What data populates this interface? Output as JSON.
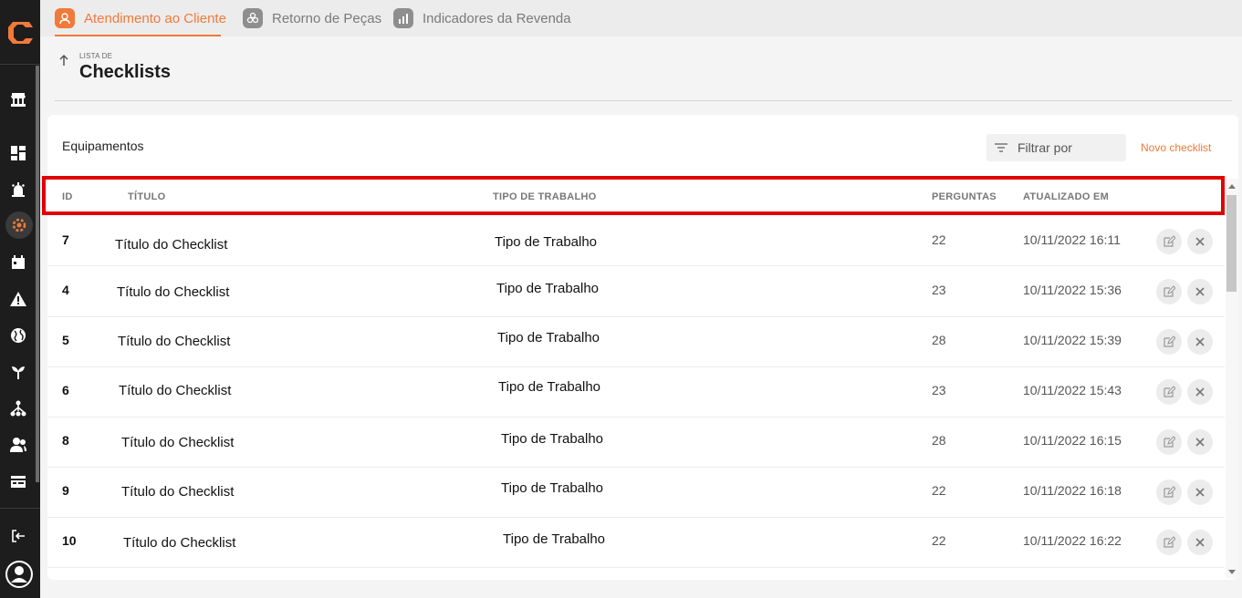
{
  "sidebar": {
    "icons": [
      "app-logo",
      "store-icon",
      "dashboard-icon",
      "alarm-icon",
      "service-gear-icon",
      "calendar-icon",
      "warning-icon",
      "globe-icon",
      "plant-icon",
      "hierarchy-icon",
      "users-icon",
      "billing-icon",
      "logout-icon",
      "account-icon"
    ]
  },
  "tabs": [
    {
      "label": "Atendimento ao Cliente",
      "active": true
    },
    {
      "label": "Retorno de Peças",
      "active": false
    },
    {
      "label": "Indicadores da Revenda",
      "active": false
    }
  ],
  "header": {
    "pre_title": "LISTA DE",
    "title": "Checklists"
  },
  "card": {
    "title": "Equipamentos",
    "filter_placeholder": "Filtrar por",
    "new_label": "Novo checklist"
  },
  "table": {
    "columns": [
      "ID",
      "TÍTULO",
      "TIPO DE TRABALHO",
      "PERGUNTAS",
      "ATUALIZADO EM"
    ],
    "rows": [
      {
        "id": "7",
        "title": "Título do Checklist",
        "work_type": "Tipo de Trabalho",
        "questions": "22",
        "updated": "10/11/2022 16:11"
      },
      {
        "id": "4",
        "title": "Título do Checklist",
        "work_type": "Tipo de Trabalho",
        "questions": "23",
        "updated": "10/11/2022 15:36"
      },
      {
        "id": "5",
        "title": "Título do Checklist",
        "work_type": "Tipo de Trabalho",
        "questions": "28",
        "updated": "10/11/2022 15:39"
      },
      {
        "id": "6",
        "title": "Título do Checklist",
        "work_type": "Tipo de Trabalho",
        "questions": "23",
        "updated": "10/11/2022 15:43"
      },
      {
        "id": "8",
        "title": "Título do Checklist",
        "work_type": "Tipo de Trabalho",
        "questions": "28",
        "updated": "10/11/2022 16:15"
      },
      {
        "id": "9",
        "title": "Título do Checklist",
        "work_type": "Tipo de Trabalho",
        "questions": "22",
        "updated": "10/11/2022 16:18"
      },
      {
        "id": "10",
        "title": "Título do Checklist",
        "work_type": "Tipo de Trabalho",
        "questions": "22",
        "updated": "10/11/2022 16:22"
      }
    ]
  },
  "colors": {
    "accent": "#f07a3a",
    "highlight": "#e00000",
    "sidebar_bg": "#1d1d1d"
  }
}
